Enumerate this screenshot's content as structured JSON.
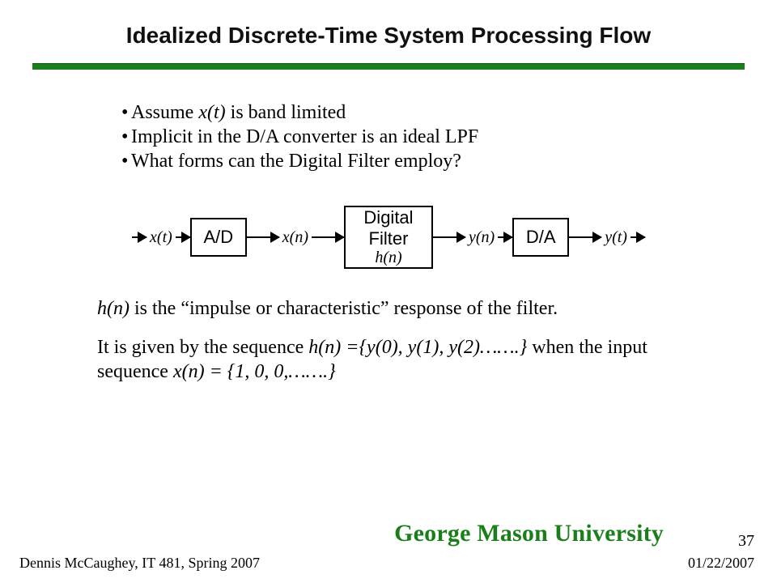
{
  "title": "Idealized Discrete-Time System Processing Flow",
  "bullets": {
    "b1_pre": "Assume ",
    "b1_var": "x(t)",
    "b1_post": " is band limited",
    "b2": "Implicit in the D/A converter is an ideal  LPF",
    "b3": "What forms can the Digital Filter employ?"
  },
  "diagram": {
    "in": "x(t)",
    "ad": "A/D",
    "xn": "x(n)",
    "filter_line1": "Digital",
    "filter_line2": "Filter",
    "filter_hn": "h(n)",
    "yn": "y(n)",
    "da": "D/A",
    "out": "y(t)"
  },
  "para1": {
    "var": "h(n)",
    "rest": " is the “impulse or characteristic” response of the filter."
  },
  "para2": {
    "pre": "It is given by the sequence ",
    "seq": "h(n) ={y(0), y(1), y(2)…….}",
    "mid": " when the input sequence ",
    "xseq": "x(n) = {1, 0, 0,…….}"
  },
  "footer": {
    "author": "Dennis McCaughey, IT 481, Spring 2007",
    "date": "01/22/2007",
    "page": "37",
    "logo": "George Mason University"
  }
}
